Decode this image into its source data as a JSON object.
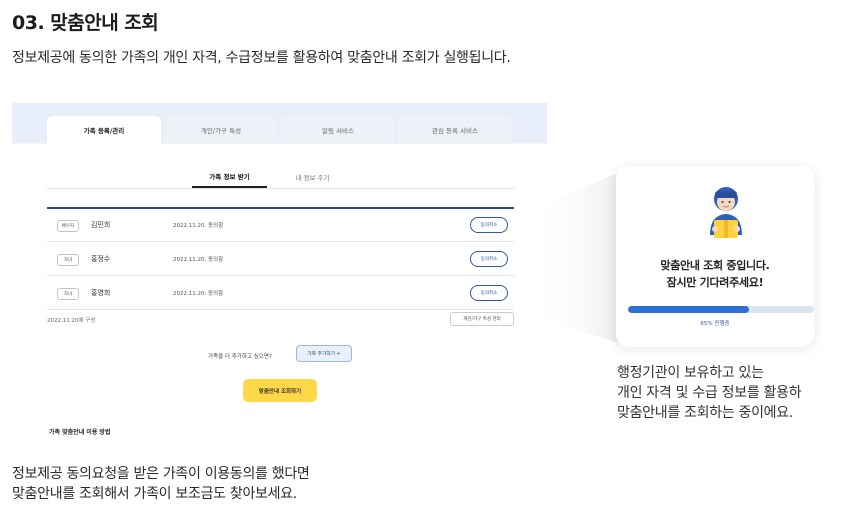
{
  "heading": {
    "title": "03. 맞춤안내 조회",
    "subtitle": "정보제공에 동의한 가족의 개인 자격, 수급정보를 활용하여 맞춤안내 조회가 실행됩니다."
  },
  "mock": {
    "tabs": [
      {
        "label": "가족 등록/관리",
        "active": true
      },
      {
        "label": "개인/가구 특성",
        "active": false
      },
      {
        "label": "알림 서비스",
        "active": false
      },
      {
        "label": "관심 등록 서비스",
        "active": false
      }
    ],
    "subtabs": [
      {
        "label": "가족 정보 받기",
        "active": true
      },
      {
        "label": "내 정보 주기",
        "active": false
      }
    ],
    "rows": [
      {
        "relation": "배우자",
        "name": "김민희",
        "date": "2022.11.20. 동의함",
        "action": "동의취소"
      },
      {
        "relation": "자녀",
        "name": "홍정수",
        "date": "2022.11.20. 동의함",
        "action": "동의취소"
      },
      {
        "relation": "자녀",
        "name": "홍영희",
        "date": "2022.11.20. 동의함",
        "action": "동의취소"
      }
    ],
    "basis_text": "2022.11.20에 구성",
    "status_button": "개인/가구 특성 관리",
    "add_prompt": "가족을 더 추가하고 싶으면?",
    "add_button": "가족 추가하기 +",
    "check_button": "맞춤안내 조회하기",
    "howto_label": "가족 맞춤안내 이용 방법"
  },
  "loading_card": {
    "line1": "맞춤안내 조회 중입니다.",
    "line2": "잠시만 기다려주세요!",
    "progress_percent": 65,
    "progress_label": "65% 진행중",
    "colors": {
      "accent": "#2d6fd6",
      "track": "#dbe4f2"
    }
  },
  "side_description": [
    "행정기관이 보유하고 있는",
    "개인 자격 및 수급 정보를 활용하",
    "맞춤안내를 조회하는 중이에요."
  ],
  "bottom_description": [
    "정보제공 동의요청을 받은 가족이 이용동의를 했다면",
    "맞춤안내를 조회해서 가족이 보조금도 찾아보세요."
  ],
  "icons": {
    "avatar": "person-holding-box-icon"
  }
}
